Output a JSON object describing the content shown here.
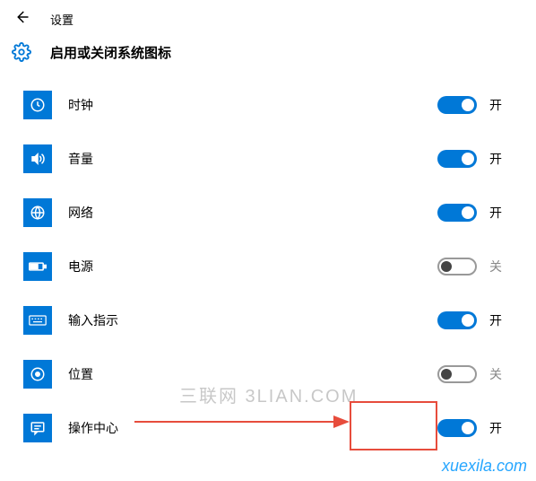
{
  "header": {
    "window_title": "设置",
    "page_title": "启用或关闭系统图标"
  },
  "toggle_labels": {
    "on": "开",
    "off": "关"
  },
  "items": [
    {
      "icon": "clock-icon",
      "label": "时钟",
      "state": "on"
    },
    {
      "icon": "volume-icon",
      "label": "音量",
      "state": "on"
    },
    {
      "icon": "network-icon",
      "label": "网络",
      "state": "on"
    },
    {
      "icon": "power-icon",
      "label": "电源",
      "state": "off"
    },
    {
      "icon": "keyboard-icon",
      "label": "输入指示",
      "state": "on"
    },
    {
      "icon": "location-icon",
      "label": "位置",
      "state": "off"
    },
    {
      "icon": "action-center-icon",
      "label": "操作中心",
      "state": "on"
    }
  ],
  "watermarks": {
    "center": "三联网 3LIAN.COM",
    "corner": "xuexila.com"
  }
}
